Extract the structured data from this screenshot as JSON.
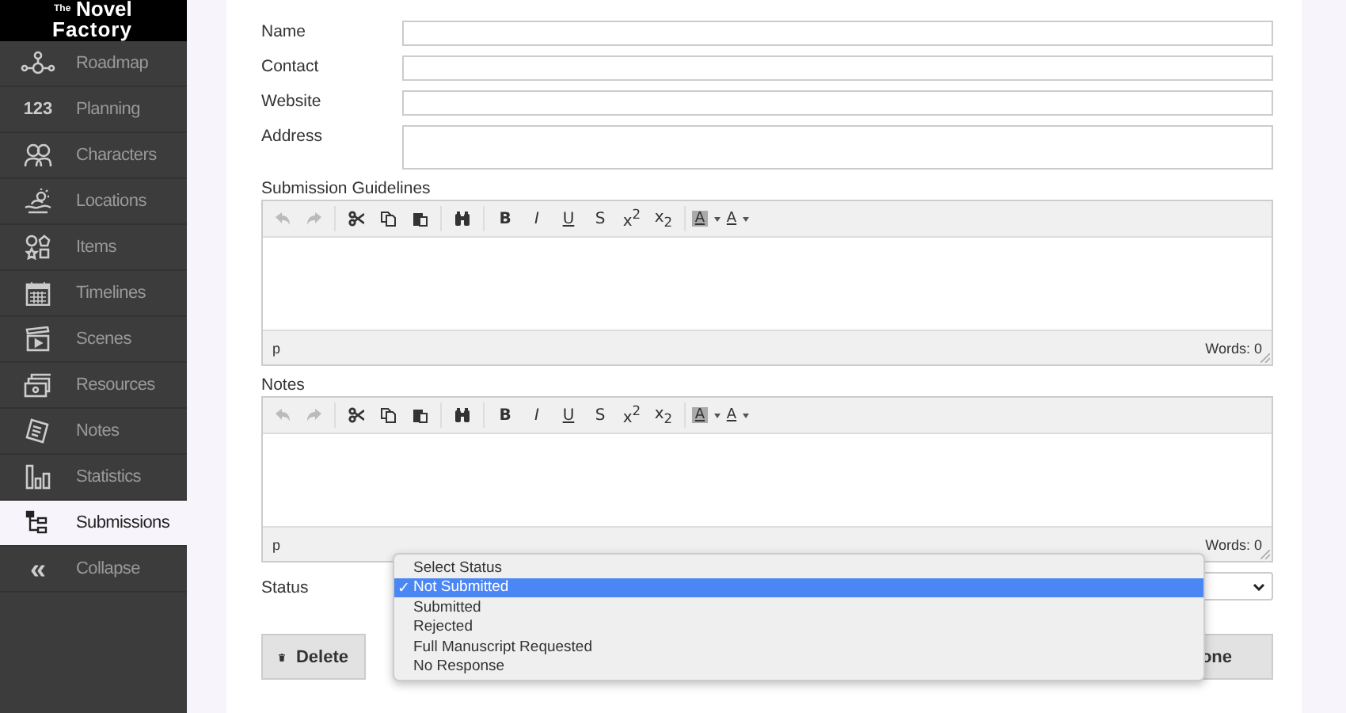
{
  "logo": {
    "small": "The",
    "line1": "Novel",
    "line2": "Factory"
  },
  "sidebar": {
    "items": [
      {
        "kind": "roadmap",
        "label": "Roadmap",
        "selected": false
      },
      {
        "kind": "planning",
        "icon_text": "123",
        "label": "Planning",
        "selected": false
      },
      {
        "kind": "characters",
        "label": "Characters",
        "selected": false
      },
      {
        "kind": "locations",
        "label": "Locations",
        "selected": false
      },
      {
        "kind": "items",
        "label": "Items",
        "selected": false
      },
      {
        "kind": "timelines",
        "label": "Timelines",
        "selected": false
      },
      {
        "kind": "scenes",
        "label": "Scenes",
        "selected": false
      },
      {
        "kind": "resources",
        "label": "Resources",
        "selected": false
      },
      {
        "kind": "notes",
        "label": "Notes",
        "selected": false
      },
      {
        "kind": "statistics",
        "label": "Statistics",
        "selected": false
      },
      {
        "kind": "submissions",
        "label": "Submissions",
        "selected": true
      },
      {
        "kind": "collapse",
        "icon_text": "«",
        "label": "Collapse",
        "selected": false
      }
    ]
  },
  "form": {
    "fields": [
      {
        "label": "Name",
        "kind": "line"
      },
      {
        "label": "Contact",
        "kind": "line"
      },
      {
        "label": "Website",
        "kind": "line"
      },
      {
        "label": "Address",
        "kind": "area"
      }
    ],
    "editors": [
      {
        "label": "Submission Guidelines",
        "path": "p",
        "words": "Words: 0",
        "toolbar": [
          {
            "kind": "undo",
            "disabled": true
          },
          {
            "kind": "redo",
            "disabled": true
          },
          {
            "kind": "sep"
          },
          {
            "kind": "cut",
            "disabled": false
          },
          {
            "kind": "copy",
            "disabled": false
          },
          {
            "kind": "paste",
            "disabled": false
          },
          {
            "kind": "sep"
          },
          {
            "kind": "find",
            "disabled": false
          },
          {
            "kind": "sep"
          },
          {
            "kind": "bold",
            "text": "B",
            "disabled": false
          },
          {
            "kind": "italic",
            "text": "I",
            "disabled": false
          },
          {
            "kind": "underline",
            "text": "U",
            "disabled": false
          },
          {
            "kind": "strike",
            "text": "S",
            "disabled": false
          },
          {
            "kind": "sup",
            "text": "x$^{2}$",
            "disabled": false
          },
          {
            "kind": "sub",
            "text": "x$_{2}$",
            "disabled": false
          },
          {
            "kind": "sep"
          },
          {
            "kind": "highlight",
            "text": "A",
            "disabled": false
          },
          {
            "kind": "color",
            "text": "A",
            "disabled": false
          }
        ]
      },
      {
        "label": "Notes",
        "path": "p",
        "words": "Words: 0",
        "toolbar": [
          {
            "kind": "undo",
            "disabled": true
          },
          {
            "kind": "redo",
            "disabled": true
          },
          {
            "kind": "sep"
          },
          {
            "kind": "cut",
            "disabled": false
          },
          {
            "kind": "copy",
            "disabled": false
          },
          {
            "kind": "paste",
            "disabled": false
          },
          {
            "kind": "sep"
          },
          {
            "kind": "find",
            "disabled": false
          },
          {
            "kind": "sep"
          },
          {
            "kind": "bold",
            "text": "B",
            "disabled": false
          },
          {
            "kind": "italic",
            "text": "I",
            "disabled": false
          },
          {
            "kind": "underline",
            "text": "U",
            "disabled": false
          },
          {
            "kind": "strike",
            "text": "S",
            "disabled": false
          },
          {
            "kind": "sup",
            "text": "x$^{2}$",
            "disabled": false
          },
          {
            "kind": "sub",
            "text": "x$_{2}$",
            "disabled": false
          },
          {
            "kind": "sep"
          },
          {
            "kind": "highlight",
            "text": "A",
            "disabled": false
          },
          {
            "kind": "color",
            "text": "A",
            "disabled": false
          }
        ]
      }
    ],
    "status": {
      "label": "Status",
      "options": [
        {
          "label": "Select Status",
          "selected": false
        },
        {
          "label": "Not Submitted",
          "selected": true
        },
        {
          "label": "Submitted",
          "selected": false
        },
        {
          "label": "Rejected",
          "selected": false
        },
        {
          "label": "Full Manuscript Requested",
          "selected": false
        },
        {
          "label": "No Response",
          "selected": false
        }
      ],
      "check": "✓"
    },
    "buttons": [
      {
        "kind": "delete",
        "label": "Delete"
      },
      {
        "kind": "done",
        "label": "one"
      }
    ]
  }
}
